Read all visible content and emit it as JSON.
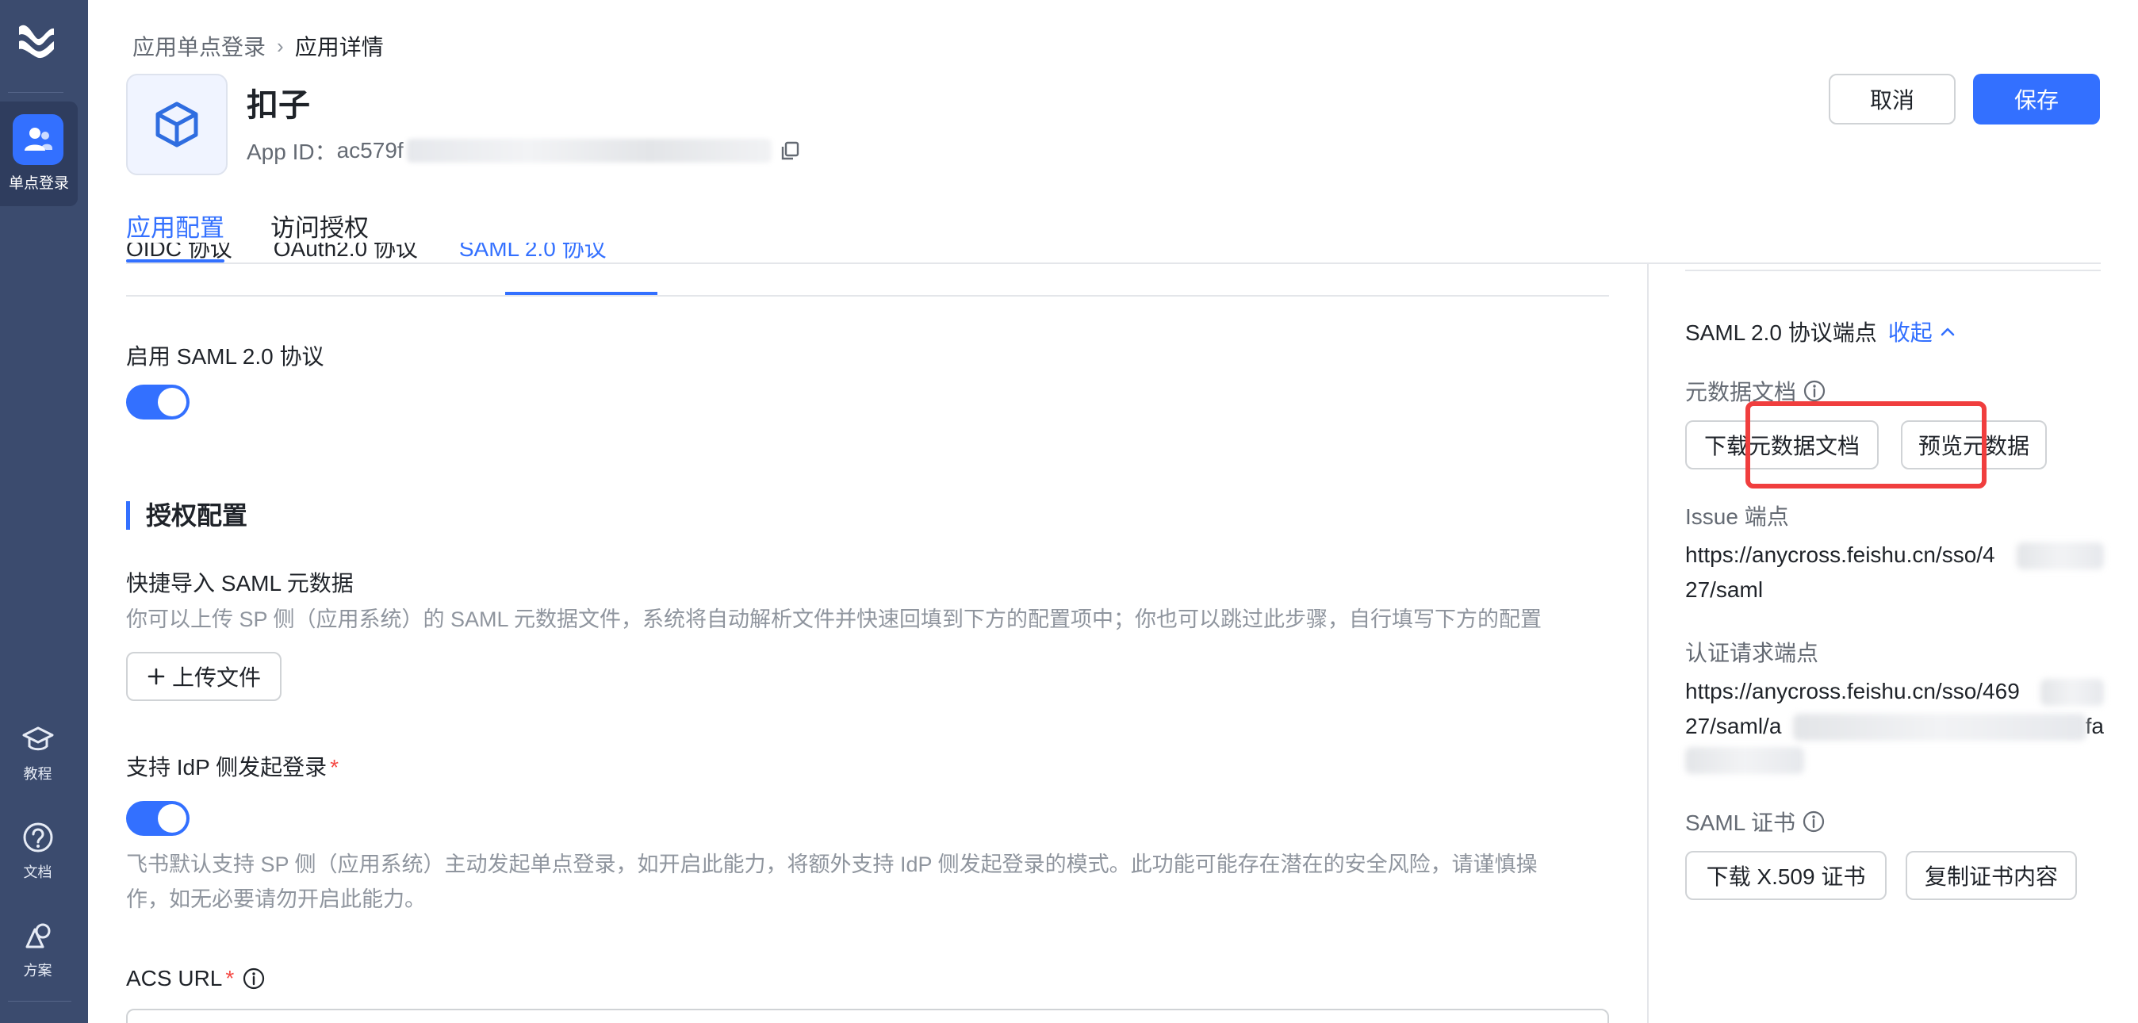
{
  "rail": {
    "active_label": "单点登录",
    "items": [
      {
        "label": "教程",
        "icon": "graduation-cap-icon"
      },
      {
        "label": "文档",
        "icon": "help-circle-icon"
      },
      {
        "label": "方案",
        "icon": "shapes-icon"
      }
    ]
  },
  "breadcrumb": {
    "parent": "应用单点登录",
    "current": "应用详情"
  },
  "app": {
    "name": "扣子",
    "id_label": "App ID：",
    "id_value": "ac579f"
  },
  "actions": {
    "cancel": "取消",
    "save": "保存"
  },
  "tabs": [
    {
      "label": "应用配置",
      "active": true
    },
    {
      "label": "访问授权",
      "active": false
    }
  ],
  "subtabs": [
    {
      "label": "OIDC 协议"
    },
    {
      "label": "OAuth2.0 协议"
    },
    {
      "label": "SAML 2.0 协议",
      "active": true
    }
  ],
  "form": {
    "enable_saml_label": "启用 SAML 2.0 协议",
    "section_title": "授权配置",
    "import_label": "快捷导入 SAML 元数据",
    "import_hint": "你可以上传 SP 侧（应用系统）的 SAML 元数据文件，系统将自动解析文件并快速回填到下方的配置项中；你也可以跳过此步骤，自行填写下方的配置",
    "upload_button": "上传文件",
    "idp_login_label": "支持 IdP 侧发起登录",
    "required_mark": "*",
    "idp_hint_line1": "飞书默认支持 SP 侧（应用系统）主动发起单点登录，如开启此能力，将额外支持 IdP 侧发起登录的模式。此功能可能存在潜在的安全风险，请谨慎操",
    "idp_hint_line2": "作，如无必要请勿开启此能力。",
    "acs_label": "ACS URL"
  },
  "panel": {
    "title": "SAML 2.0 协议端点",
    "collapse": "收起",
    "metadata_label": "元数据文档",
    "download_metadata": "下载元数据文档",
    "preview_metadata": "预览元数据",
    "issue_label": "Issue 端点",
    "issue_line1": "https://anycross.feishu.cn/sso/4",
    "issue_line2": "27/saml",
    "auth_label": "认证请求端点",
    "auth_line1": "https://anycross.feishu.cn/sso/469",
    "auth_line2a": "27/saml/a",
    "auth_line2b": "fa",
    "cert_label": "SAML 证书",
    "download_cert": "下载 X.509 证书",
    "copy_cert": "复制证书内容"
  }
}
